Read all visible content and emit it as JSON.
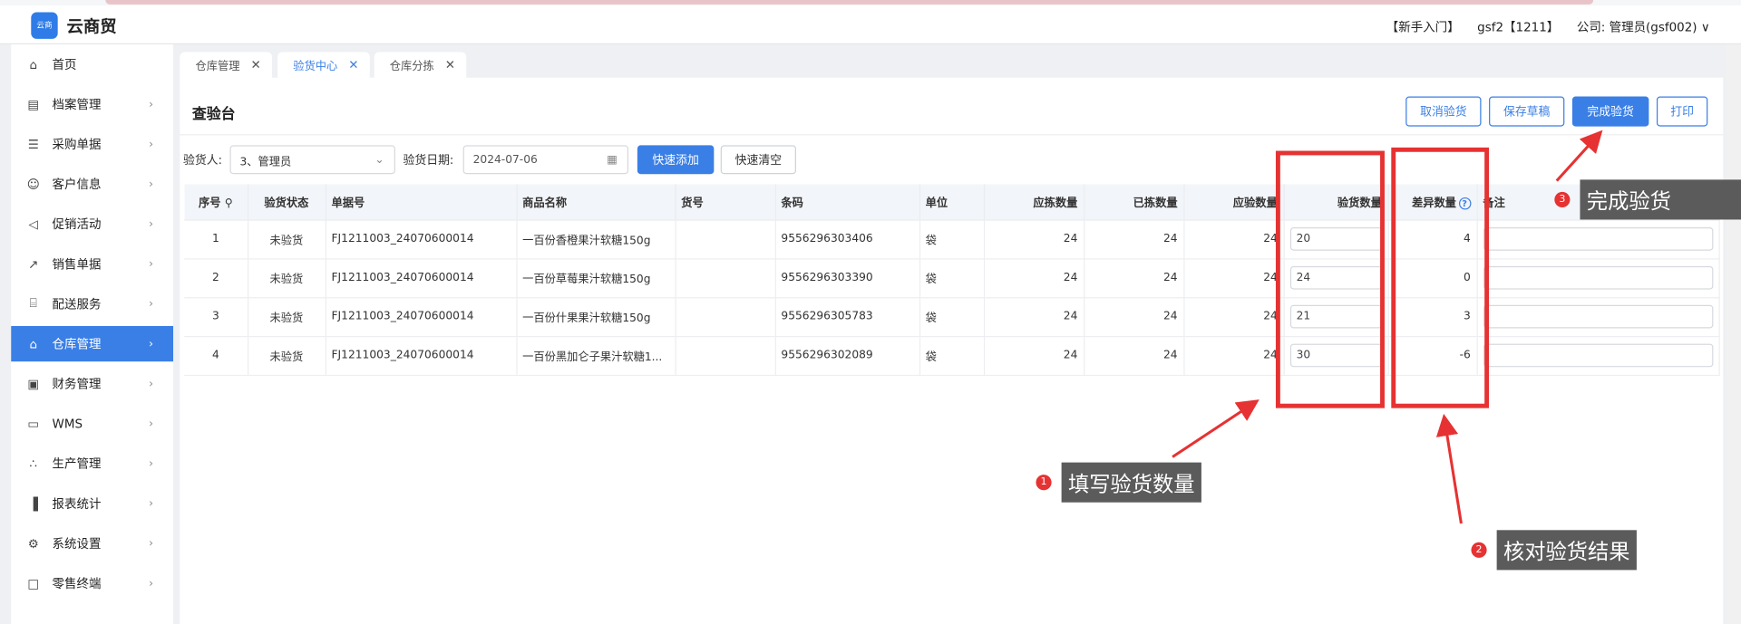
{
  "app": {
    "logo_text": "云商",
    "brand": "云商贸"
  },
  "header": {
    "guide": "【新手入门】",
    "user": "gsf2【1211】",
    "company": "公司: 管理员(gsf002)",
    "caret": "∨"
  },
  "sidebar": {
    "items": [
      {
        "label": "首页",
        "icon": "home-icon",
        "glyph": "⌂"
      },
      {
        "label": "档案管理",
        "icon": "archive-icon",
        "glyph": "▤"
      },
      {
        "label": "采购单据",
        "icon": "purchase-doc-icon",
        "glyph": "☰"
      },
      {
        "label": "客户信息",
        "icon": "user-icon",
        "glyph": "☺"
      },
      {
        "label": "促销活动",
        "icon": "megaphone-icon",
        "glyph": "◁"
      },
      {
        "label": "销售单据",
        "icon": "chart-line-icon",
        "glyph": "↗"
      },
      {
        "label": "配送服务",
        "icon": "cart-icon",
        "glyph": "⌸"
      },
      {
        "label": "仓库管理",
        "icon": "warehouse-icon",
        "glyph": "⌂"
      },
      {
        "label": "财务管理",
        "icon": "finance-icon",
        "glyph": "▣"
      },
      {
        "label": "WMS",
        "icon": "wms-icon",
        "glyph": "▭"
      },
      {
        "label": "生产管理",
        "icon": "production-icon",
        "glyph": "∴"
      },
      {
        "label": "报表统计",
        "icon": "report-icon",
        "glyph": "▐"
      },
      {
        "label": "系统设置",
        "icon": "gear-icon",
        "glyph": "⚙"
      },
      {
        "label": "零售终端",
        "icon": "terminal-icon",
        "glyph": "□"
      }
    ],
    "active_index": 7,
    "arrow": "›"
  },
  "tabs": [
    {
      "label": "仓库管理",
      "active": false
    },
    {
      "label": "验货中心",
      "active": true
    },
    {
      "label": "仓库分拣",
      "active": false
    }
  ],
  "tab_close": "✕",
  "page": {
    "title": "查验台"
  },
  "actions": {
    "cancel": "取消验货",
    "save_draft": "保存草稿",
    "complete": "完成验货",
    "print": "打印"
  },
  "filters": {
    "inspector_label": "验货人:",
    "inspector_value": "3、管理员",
    "inspector_caret": "⌄",
    "date_label": "验货日期:",
    "date_value": "2024-07-06",
    "date_icon": "▦",
    "quick_add": "快速添加",
    "quick_clear": "快速清空"
  },
  "table": {
    "headers": {
      "index": "序号",
      "status": "验货状态",
      "doc_no": "单据号",
      "product": "商品名称",
      "item_no": "货号",
      "barcode": "条码",
      "unit": "单位",
      "should_pick": "应拣数量",
      "picked": "已拣数量",
      "should_inspect": "应验数量",
      "inspected": "验货数量",
      "diff": "差异数量",
      "remark": "备注"
    },
    "help_glyph": "?",
    "rows": [
      {
        "index": "1",
        "status": "未验货",
        "doc_no": "FJ1211003_24070600014",
        "product": "一百份香橙果汁软糖150g",
        "item_no": "",
        "barcode": "9556296303406",
        "unit": "袋",
        "should_pick": "24",
        "picked": "24",
        "should_inspect": "24",
        "inspected": "20",
        "diff": "4",
        "remark": ""
      },
      {
        "index": "2",
        "status": "未验货",
        "doc_no": "FJ1211003_24070600014",
        "product": "一百份草莓果汁软糖150g",
        "item_no": "",
        "barcode": "9556296303390",
        "unit": "袋",
        "should_pick": "24",
        "picked": "24",
        "should_inspect": "24",
        "inspected": "24",
        "diff": "0",
        "remark": ""
      },
      {
        "index": "3",
        "status": "未验货",
        "doc_no": "FJ1211003_24070600014",
        "product": "一百份什果果汁软糖150g",
        "item_no": "",
        "barcode": "9556296305783",
        "unit": "袋",
        "should_pick": "24",
        "picked": "24",
        "should_inspect": "24",
        "inspected": "21",
        "diff": "3",
        "remark": ""
      },
      {
        "index": "4",
        "status": "未验货",
        "doc_no": "FJ1211003_24070600014",
        "product": "一百份黑加仑子果汁软糖1...",
        "item_no": "",
        "barcode": "9556296302089",
        "unit": "袋",
        "should_pick": "24",
        "picked": "24",
        "should_inspect": "24",
        "inspected": "30",
        "diff": "-6",
        "remark": ""
      }
    ]
  },
  "annotations": [
    {
      "num": "1",
      "text": "填写验货数量"
    },
    {
      "num": "2",
      "text": "核对验货结果"
    },
    {
      "num": "3",
      "text": "完成验货"
    }
  ],
  "colors": {
    "accent": "#3a7fe6",
    "annotation_red": "#e63232",
    "callout_bg": "#5b5b5b"
  }
}
